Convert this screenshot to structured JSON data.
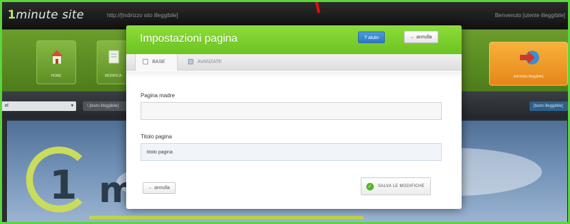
{
  "app": {
    "logo_prefix": "1",
    "logo_text": "minute site",
    "url": "http://[indirizzo sito illeggibile]",
    "user_info": "Benvenuto [utente illeggibile]"
  },
  "nav": {
    "home_label": "HOME",
    "pages_label": "MODIFICA",
    "orange_label": "[etichetta illeggibile]"
  },
  "toolbar": {
    "select_value": "el",
    "select_caret": "▾",
    "button_label": "\\ [testo illeggibile]",
    "right_button_label": "[testo illeggibile]"
  },
  "preview": {
    "big_number": "1",
    "big_letter": "m"
  },
  "modal": {
    "title": "Impostazioni pagina",
    "help_label": "? aiuto",
    "close_label": "← annulla",
    "tabs": [
      {
        "label": "BASE"
      },
      {
        "label": "AVANZATE"
      }
    ],
    "fields": {
      "parent_page_label": "Pagina madre",
      "parent_page_value": "",
      "page_title_label": "Titolo pagina",
      "page_title_value": "titolo pagina"
    },
    "back_label": "← annulla",
    "save_label": "SALVA LE MODIFICHE",
    "save_icon": "✓"
  },
  "colors": {
    "frame_green": "#5bd63c",
    "header_green": "#7ccf2c",
    "help_blue": "#3a89d2",
    "annotation_red": "#e01010"
  }
}
